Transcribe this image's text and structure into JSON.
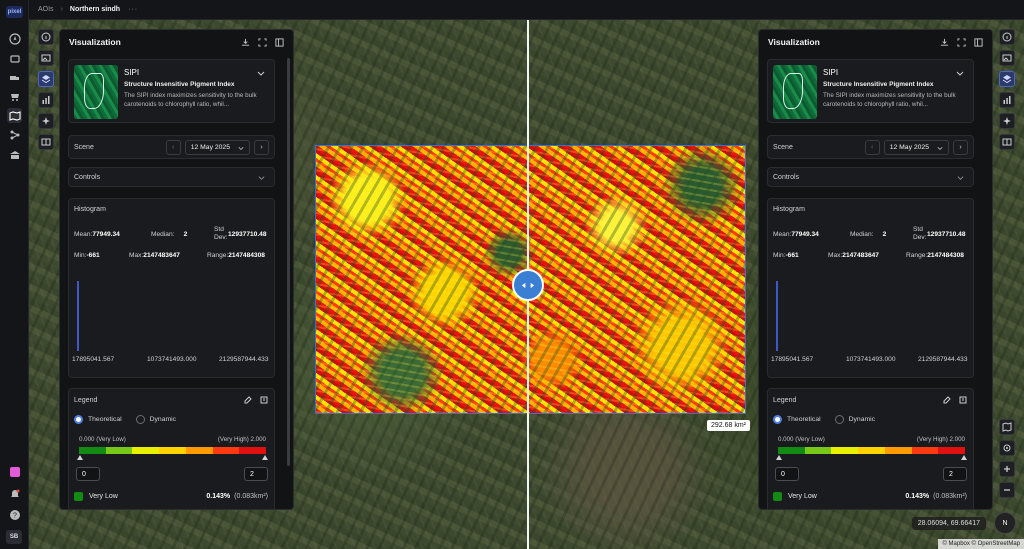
{
  "app": {
    "logo_text": "pixel",
    "user_initials": "SB"
  },
  "breadcrumb": {
    "root": "AOIs",
    "current": "Northern sindh",
    "more": "···"
  },
  "map": {
    "area_label": "292.68 km²",
    "coordinates": "28.06094, 69.66417",
    "compass": "N",
    "attribution": "© Mapbox © OpenStreetMap"
  },
  "panels": [
    {
      "title": "Visualization",
      "index": {
        "name": "SIPI",
        "full_name": "Structure Insensitive Pigment Index",
        "description": "The SIPI index maximizes sensitivity to the bulk carotenoids to chlorophyll ratio, whil..."
      },
      "scene": {
        "label": "Scene",
        "date": "12 May 2025",
        "prev": "‹",
        "next": "›"
      },
      "controls": {
        "label": "Controls"
      },
      "histogram": {
        "title": "Histogram",
        "mean_label": "Mean:",
        "mean": "77949.34",
        "median_label": "Median:",
        "median": "2",
        "std_label": "Std Dev:",
        "std": "12937710.48",
        "min_label": "Min:",
        "min": "-661",
        "max_label": "Max:",
        "max": "2147483647",
        "range_label": "Range:",
        "range": "2147484308",
        "axis": [
          "17895041.567",
          "1073741493.000",
          "2129587944.433"
        ]
      },
      "legend": {
        "title": "Legend",
        "theoretical": "Theoretical",
        "dynamic": "Dynamic",
        "low_label": "0.000 (Very Low)",
        "high_label": "(Very High) 2.000",
        "min_value": "0",
        "max_value": "2",
        "item_name": "Very Low",
        "item_pct": "0.143%",
        "item_area": "(0.083km²)"
      }
    },
    {
      "title": "Visualization",
      "index": {
        "name": "SIPI",
        "full_name": "Structure Insensitive Pigment Index",
        "description": "The SIPI index maximizes sensitivity to the bulk carotenoids to chlorophyll ratio, whil..."
      },
      "scene": {
        "label": "Scene",
        "date": "12 May 2025",
        "prev": "‹",
        "next": "›"
      },
      "controls": {
        "label": "Controls"
      },
      "histogram": {
        "title": "Histogram",
        "mean_label": "Mean:",
        "mean": "77949.34",
        "median_label": "Median:",
        "median": "2",
        "std_label": "Std Dev:",
        "std": "12937710.48",
        "min_label": "Min:",
        "min": "-661",
        "max_label": "Max:",
        "max": "2147483647",
        "range_label": "Range:",
        "range": "2147484308",
        "axis": [
          "17895041.567",
          "1073741493.000",
          "2129587944.433"
        ]
      },
      "legend": {
        "title": "Legend",
        "theoretical": "Theoretical",
        "dynamic": "Dynamic",
        "low_label": "0.000 (Very Low)",
        "high_label": "(Very High) 2.000",
        "min_value": "0",
        "max_value": "2",
        "item_name": "Very Low",
        "item_pct": "0.143%",
        "item_area": "(0.083km²)"
      }
    }
  ],
  "legend_ramp": [
    "#138a13",
    "#78c81a",
    "#e6f000",
    "#ffd200",
    "#ff9b00",
    "#ff3a10",
    "#e01010"
  ],
  "colors": {
    "accent": "#4f7fe6",
    "aoi_border": "#3a6fd8"
  }
}
